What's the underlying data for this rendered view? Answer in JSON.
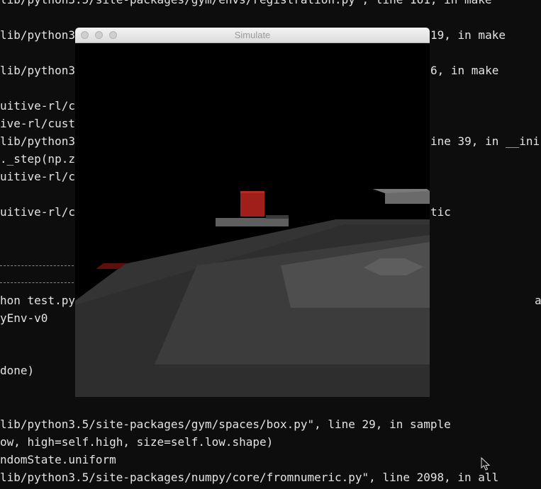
{
  "terminal": {
    "lines": [
      "lib/python3.5/site-packages/gym/envs/registration.py\", line 161, in make",
      "lib/python3",
      "lib/python3",
      "uitive-rl/c",
      "ive-rl/cust",
      "lib/python3",
      "._step(np.z",
      "uitive-rl/c",
      "uitive-rl/c",
      "hon test.py",
      "yEnv-v0",
      "done)",
      "lib/python3.5/site-packages/gym/spaces/box.py\", line 29, in sample",
      "ow, high=self.high, size=self.low.shape)",
      "ndomState.uniform",
      "lib/python3.5/site-packages/numpy/core/fromnumeric.py\", line 2098, in all"
    ],
    "right_fragments": [
      "19, in make",
      "6, in make",
      "ine 39, in __ini",
      "tic",
      "a"
    ]
  },
  "simulate_window": {
    "title": "Simulate"
  }
}
